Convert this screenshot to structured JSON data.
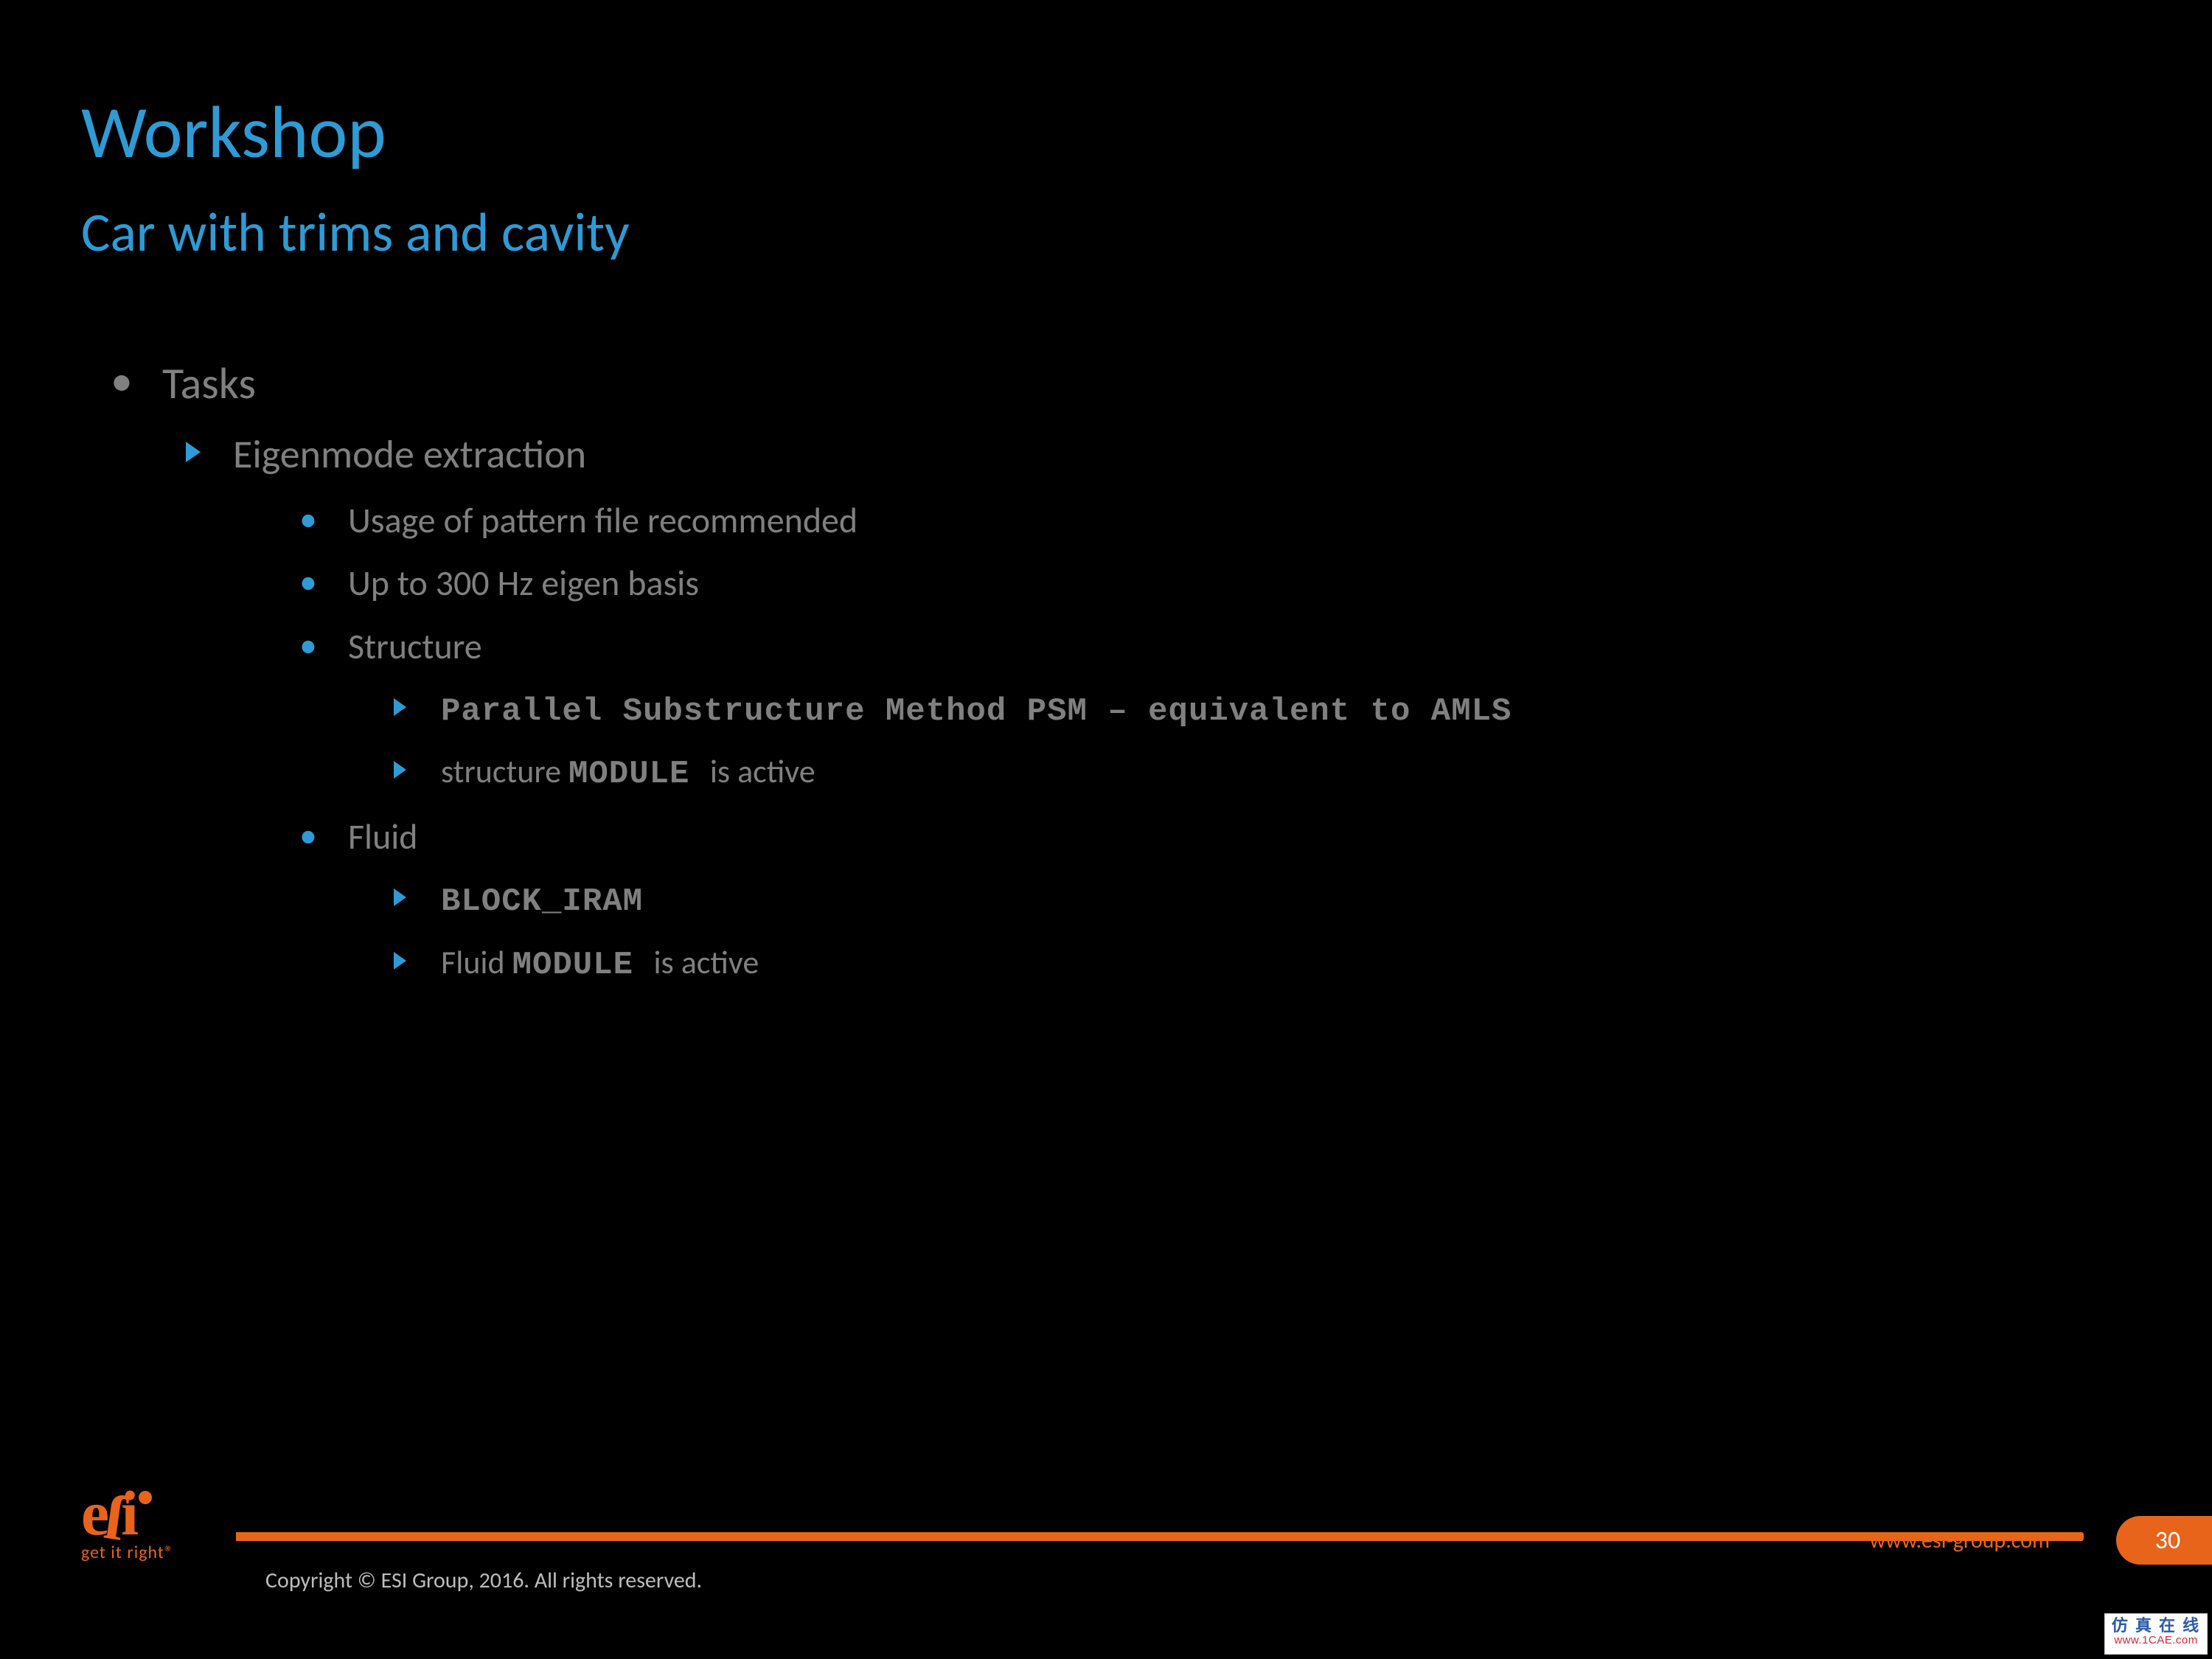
{
  "title": "Workshop",
  "subtitle": "Car with trims and cavity",
  "body": {
    "tasks_label": "Tasks",
    "eigen_label": "Eigenmode extraction",
    "pattern_line": "Usage of pattern file recommended",
    "hz_line": "Up to 300 Hz eigen basis",
    "structure_label": "Structure",
    "psm_line": "Parallel Substructure Method PSM – equivalent to AMLS",
    "struct_mod_pre": "structure ",
    "struct_mod_code": "MODULE ",
    "struct_mod_post": " is active",
    "fluid_label": "Fluid",
    "block_iram": "BLOCK_IRAM",
    "fluid_mod_pre": "Fluid ",
    "fluid_mod_code": "MODULE ",
    "fluid_mod_post": " is active"
  },
  "footer": {
    "copyright": "Copyright © ESI Group, 2016. All rights reserved.",
    "url": "www.esi-group.com",
    "page": "30"
  },
  "logo": {
    "mark": "e ſ i",
    "tag": "get it right®"
  },
  "watermark": {
    "l1": "仿 真 在 线",
    "l2": "www.1CAE.com"
  }
}
